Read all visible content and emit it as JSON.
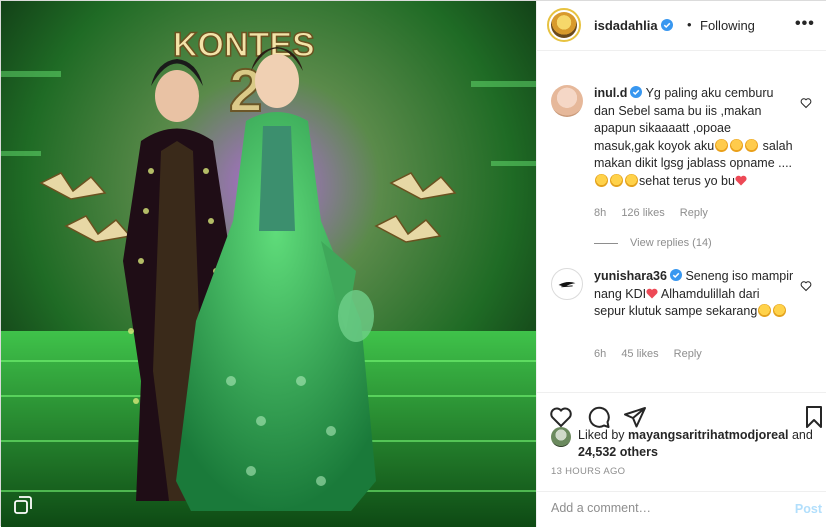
{
  "header": {
    "username": "isdadahlia",
    "separator": "•",
    "follow_status": "Following",
    "more": "•••"
  },
  "photo": {
    "stage_text": "KONTES",
    "stage_number": "2"
  },
  "comments": [
    {
      "username": "inul.d",
      "text_parts": [
        "Yg paling aku cemburu dan Sebel sama bu iis ,makan apapun sikaaaatt ,opoae masuk,gak koyok aku",
        " salah makan dikit lgsg jablass opname ....",
        "sehat terus yo bu"
      ],
      "time": "8h",
      "likes": "126 likes",
      "reply": "Reply",
      "view_replies": "View replies (14)"
    },
    {
      "username": "yunishara36",
      "text_parts": [
        "Seneng iso mampir nang KDI",
        " Alhamdulillah dari sepur klutuk sampe sekarang"
      ],
      "time": "6h",
      "likes": "45 likes",
      "reply": "Reply"
    }
  ],
  "likes": {
    "prefix": "Liked by ",
    "user": "mayangsaritrihatmodjoreal",
    "middle": " and",
    "count": "24,532 others"
  },
  "time_ago": "13 HOURS AGO",
  "add_comment": {
    "placeholder": "Add a comment…",
    "post_label": "Post"
  },
  "colors": {
    "verified": "#3897f0",
    "heart_red": "#ed4956",
    "post_disabled": "#b2dffc",
    "stage_green": "#2fd14a"
  },
  "icons": [
    "heart-icon",
    "comment-icon",
    "share-icon",
    "bookmark-icon",
    "verified-icon",
    "carousel-icon"
  ]
}
